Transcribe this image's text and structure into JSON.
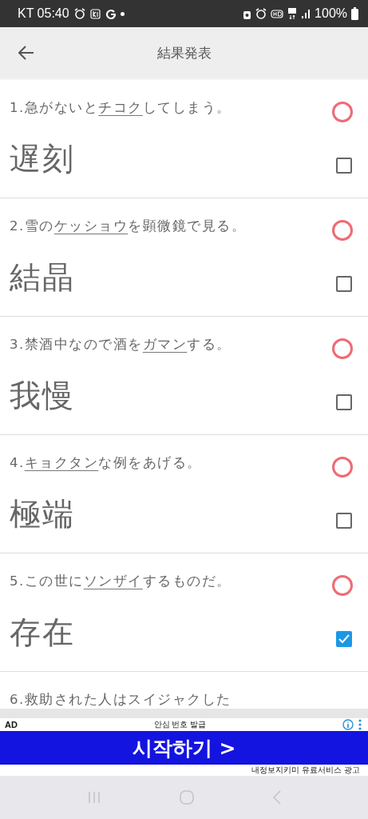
{
  "status_bar": {
    "carrier_time": "KT 05:40",
    "battery": "100%"
  },
  "app_bar": {
    "title": "結果発表"
  },
  "items": [
    {
      "question": {
        "before": "1.急がないと",
        "underlined": "チコク",
        "after": "してしまう。"
      },
      "answer": "遅刻",
      "correct": true,
      "checked": false
    },
    {
      "question": {
        "before": "2.雪の",
        "underlined": "ケッショウ",
        "after": "を顕微鏡で見る。"
      },
      "answer": "結晶",
      "correct": true,
      "checked": false
    },
    {
      "question": {
        "before": "3.禁酒中なので酒を",
        "underlined": "ガマン",
        "after": "する。"
      },
      "answer": "我慢",
      "correct": true,
      "checked": false
    },
    {
      "question": {
        "before": "4.",
        "underlined": "キョクタン",
        "after": "な例をあげる。"
      },
      "answer": "極端",
      "correct": true,
      "checked": false
    },
    {
      "question": {
        "before": "5.この世に",
        "underlined": "ソンザイ",
        "after": "するものだ。"
      },
      "answer": "存在",
      "correct": true,
      "checked": true
    },
    {
      "question": {
        "before": "6.救助された人はスイジャクした"
      }
    }
  ],
  "ad": {
    "label": "AD",
    "headline": "안심 번호 발급",
    "button": "시작하기 >",
    "footer": "내정보지키미 유료서비스 광고"
  }
}
